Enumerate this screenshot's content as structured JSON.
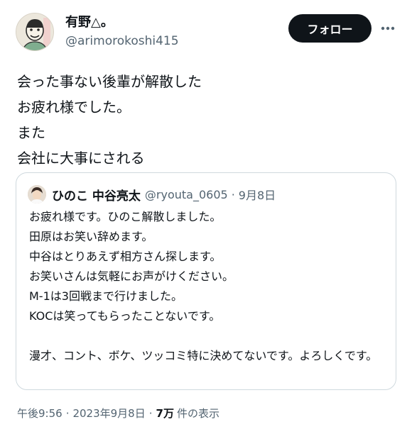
{
  "author": {
    "display_name": "有野△。",
    "handle": "@arimorokoshi415"
  },
  "follow_label": "フォロー",
  "tweet_lines": [
    "会った事ない後輩が解散した",
    "お疲れ様でした。",
    "また",
    "会社に大事にされる"
  ],
  "quote": {
    "display_name": "ひのこ 中谷亮太",
    "handle": "@ryouta_0605",
    "dot": "·",
    "date": "9月8日",
    "lines": [
      "お疲れ様です。ひのこ解散しました。",
      "田原はお笑い辞めます。",
      "中谷はとりあえず相方さん探します。",
      "お笑いさんは気軽にお声がけください。",
      "M-1は3回戦まで行けました。",
      "KOCは笑ってもらったことないです。",
      "",
      "漫才、コント、ボケ、ツッコミ特に決めてないです。よろしくです。"
    ]
  },
  "meta": {
    "time": "午後9:56",
    "sep": "·",
    "date": "2023年9月8日",
    "views_count": "7万",
    "views_label": "件の表示"
  },
  "icons": {
    "more": "more-horizontal-icon"
  },
  "colors": {
    "text": "#0f1419",
    "secondary": "#536471",
    "border": "#cfd9de",
    "button": "#0f1419"
  }
}
